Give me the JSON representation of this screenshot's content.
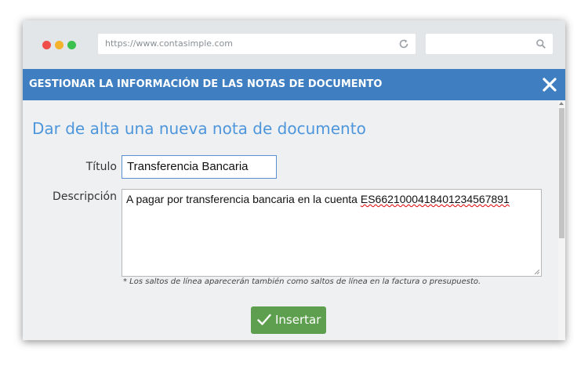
{
  "browser": {
    "url": "https://www.contasimple.com",
    "search_placeholder": ""
  },
  "dialog": {
    "title": "GESTIONAR LA INFORMACIÓN DE LAS NOTAS DE DOCUMENTO",
    "heading": "Dar de alta una nueva nota de documento",
    "titulo_label": "Título",
    "titulo_value": "Transferencia Bancaria",
    "descripcion_label": "Descripción",
    "descripcion_text": "A pagar por transferencia bancaria en la cuenta ",
    "descripcion_account": "ES6621000418401234567891",
    "note": "* Los saltos de línea aparecerán también como saltos de línea en la factura o presupuesto.",
    "insert_label": "Insertar"
  },
  "colors": {
    "titlebar": "#3f7fc1",
    "heading": "#4e96dc",
    "insert_button": "#5d9f4e"
  }
}
